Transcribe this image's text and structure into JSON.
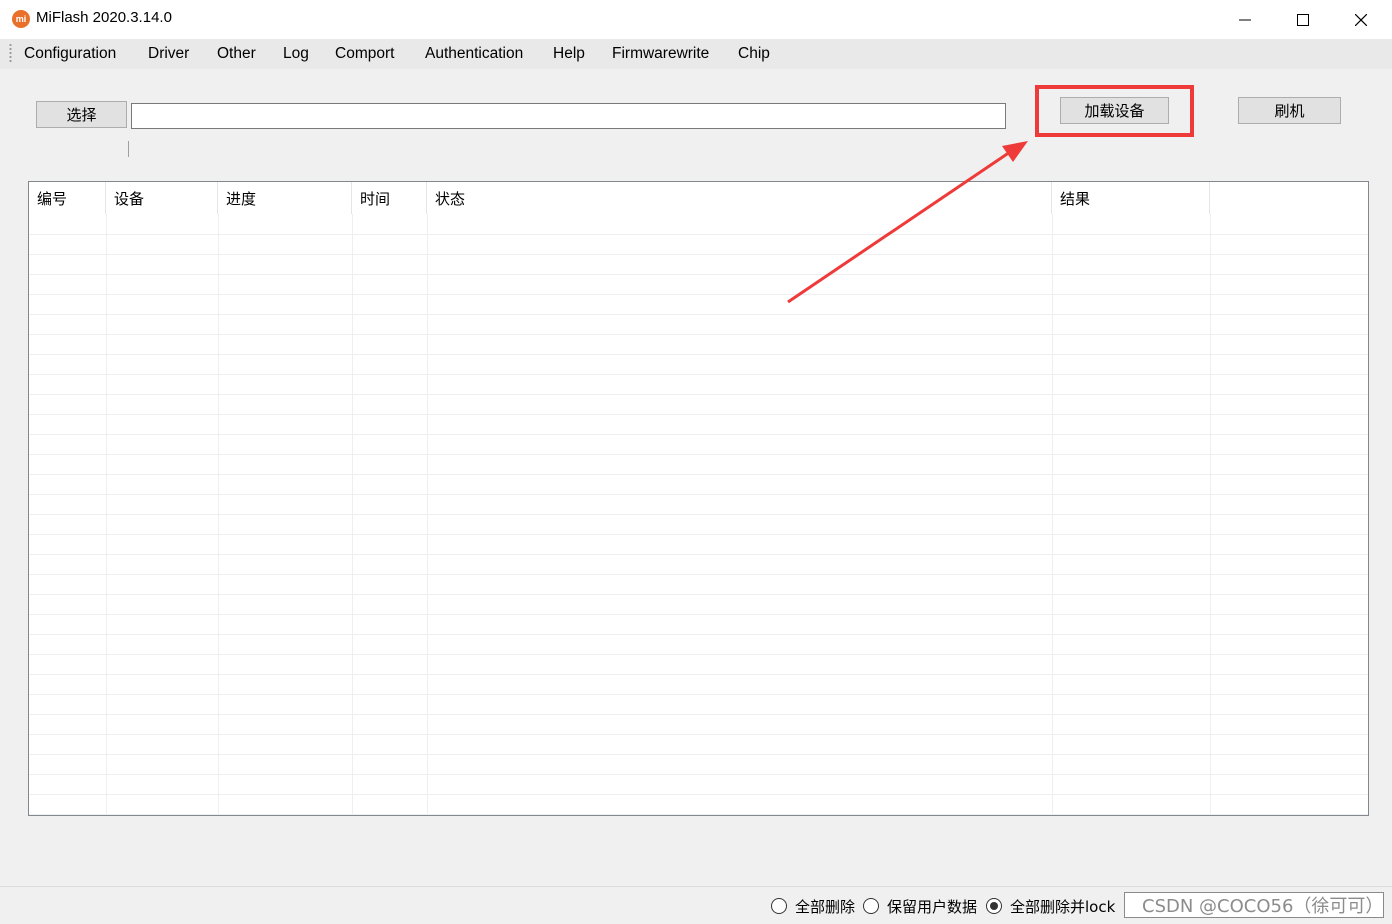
{
  "window": {
    "logo_text": "mi",
    "title": "MiFlash 2020.3.14.0"
  },
  "menu": [
    "Configuration",
    "Driver",
    "Other",
    "Log",
    "Comport",
    "Authentication",
    "Help",
    "Firmwarewrite",
    "Chip"
  ],
  "toolbar": {
    "select_label": "选择",
    "path_value": "",
    "load_device_label": "加载设备",
    "flash_label": "刷机"
  },
  "table": {
    "columns": [
      "编号",
      "设备",
      "进度",
      "时间",
      "状态",
      "结果"
    ],
    "rows": []
  },
  "options": {
    "radio_clean_all": "全部删除",
    "radio_save_user_data": "保留用户数据",
    "radio_clean_all_lock": "全部删除并lock",
    "selected": "radio_clean_all_lock"
  },
  "watermark": "CSDN @COCO56（徐可可）",
  "colors": {
    "highlight": "#ef3a3a",
    "logo": "#e8702b"
  }
}
